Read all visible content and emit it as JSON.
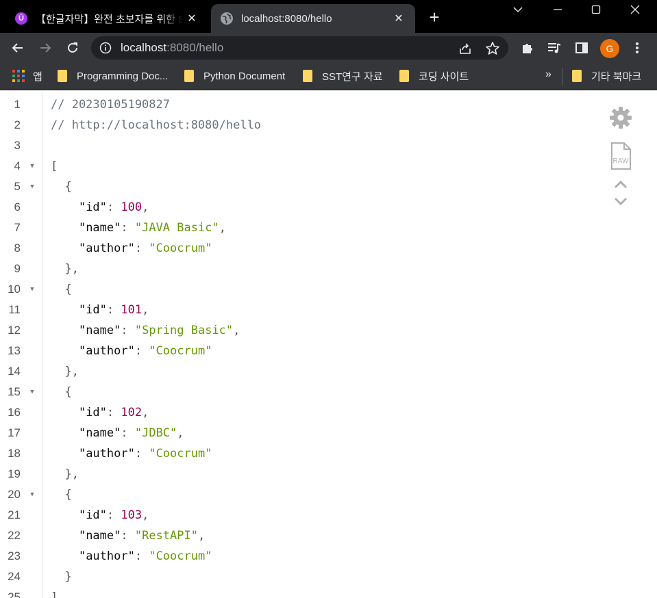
{
  "tabs": [
    {
      "title": "【한글자막】완전 초보자를 위한 Spring",
      "active": false,
      "close": "✕"
    },
    {
      "title": "localhost:8080/hello",
      "active": true,
      "close": "✕"
    }
  ],
  "new_tab_label": "+",
  "toolbar": {
    "url_host": "localhost",
    "url_rest": ":8080/hello",
    "avatar_letter": "G"
  },
  "bookmarks": {
    "apps_label": "앱",
    "items": [
      "Programming Doc...",
      "Python Document",
      "SST연구 자료",
      "코딩 사이트"
    ],
    "more": "»",
    "other": "기타 북마크"
  },
  "editor": {
    "line_numbers": [
      "1",
      "2",
      "3",
      "4",
      "5",
      "6",
      "7",
      "8",
      "9",
      "10",
      "11",
      "12",
      "13",
      "14",
      "15",
      "16",
      "17",
      "18",
      "19",
      "20",
      "21",
      "22",
      "23",
      "24",
      "25"
    ],
    "comments": [
      "// 20230105190827",
      "// http://localhost:8080/hello"
    ],
    "brackets": {
      "open_array": "[",
      "open_obj": "{",
      "close_obj": "}",
      "close_obj_comma": "},",
      "close_array": "]"
    },
    "records": [
      {
        "id": "100",
        "name": "\"JAVA Basic\"",
        "author": "\"Coocrum\""
      },
      {
        "id": "101",
        "name": "\"Spring Basic\"",
        "author": "\"Coocrum\""
      },
      {
        "id": "102",
        "name": "\"JDBC\"",
        "author": "\"Coocrum\""
      },
      {
        "id": "103",
        "name": "\"RestAPI\"",
        "author": "\"Coocrum\""
      }
    ],
    "keys": {
      "id": "\"id\"",
      "name": "\"name\"",
      "author": "\"author\""
    },
    "colon": ": ",
    "comma": ","
  },
  "side_tools": {
    "raw_label": "RAW"
  },
  "colors": {
    "tabstrip": "#000000",
    "toolbar": "#35363a",
    "omnibox": "#202124",
    "number": "#990055",
    "string": "#669900",
    "avatar": "#e8710a",
    "folder": "#fdd663"
  }
}
